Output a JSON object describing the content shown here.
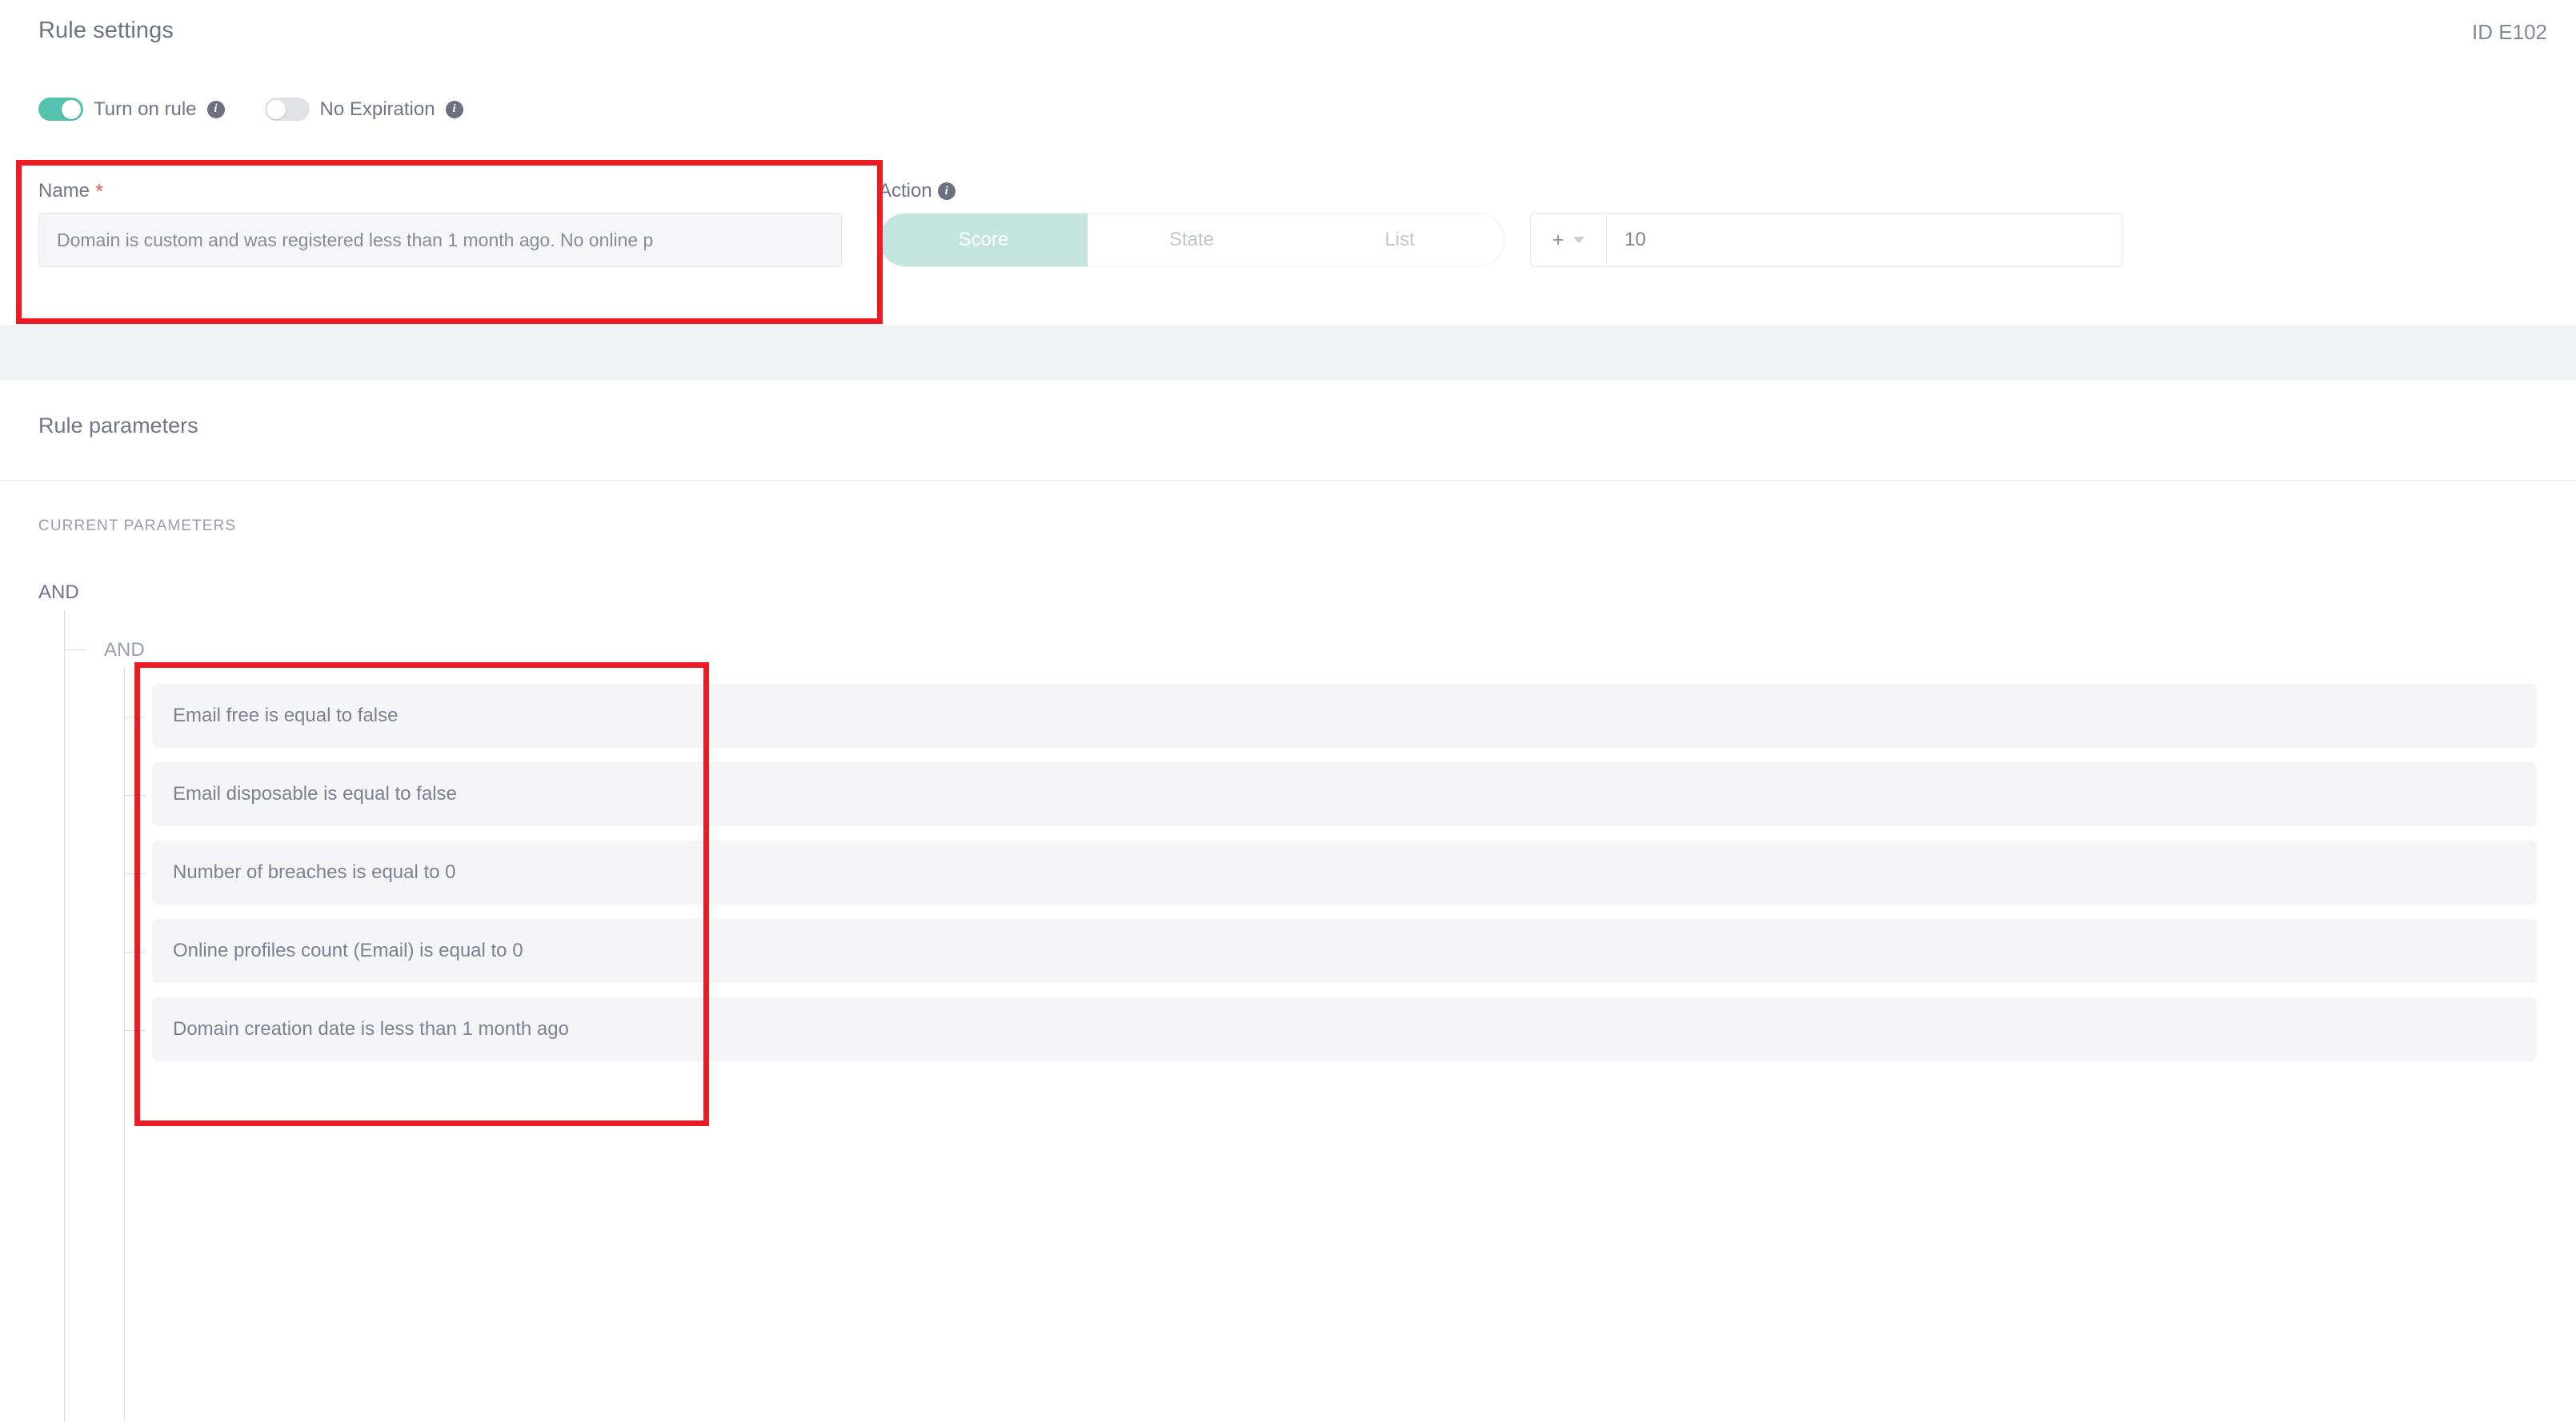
{
  "header": {
    "title": "Rule settings",
    "rule_id": "ID E102"
  },
  "toggles": [
    {
      "label": "Turn on rule",
      "state": "on",
      "info_icon": "info-icon",
      "on_color": "#53c3b0"
    },
    {
      "label": "No Expiration",
      "state": "off",
      "info_icon": "info-icon",
      "off_color": "#e0e2e6"
    }
  ],
  "name_field": {
    "label": "Name",
    "required_marker": "*",
    "value": "Domain is custom and was registered less than 1 month ago. No online p",
    "placeholder": "Name"
  },
  "action": {
    "label": "Action",
    "info_icon": "info-icon",
    "tabs": [
      {
        "label": "Score",
        "active": true
      },
      {
        "label": "State",
        "active": false
      },
      {
        "label": "List",
        "active": false
      }
    ],
    "active_color": "#c3e4df",
    "operator": "+",
    "operator_icon": "chevron-down-icon",
    "value": "10"
  },
  "rule_parameters": {
    "title": "Rule parameters",
    "current_label": "CURRENT PARAMETERS",
    "outer_operator": "AND",
    "inner_operator": "AND",
    "rows": [
      {
        "text": "Email free is equal to false"
      },
      {
        "text": "Email disposable is equal to false"
      },
      {
        "text": "Number of breaches is equal to 0"
      },
      {
        "text": "Online profiles count (Email) is equal to 0"
      },
      {
        "text": "Domain creation date is less than 1 month ago"
      }
    ]
  },
  "annotations": {
    "accent_color": "#ed1c24",
    "boxes": [
      {
        "name": "name-field-highlight"
      },
      {
        "name": "parameters-highlight"
      }
    ]
  }
}
